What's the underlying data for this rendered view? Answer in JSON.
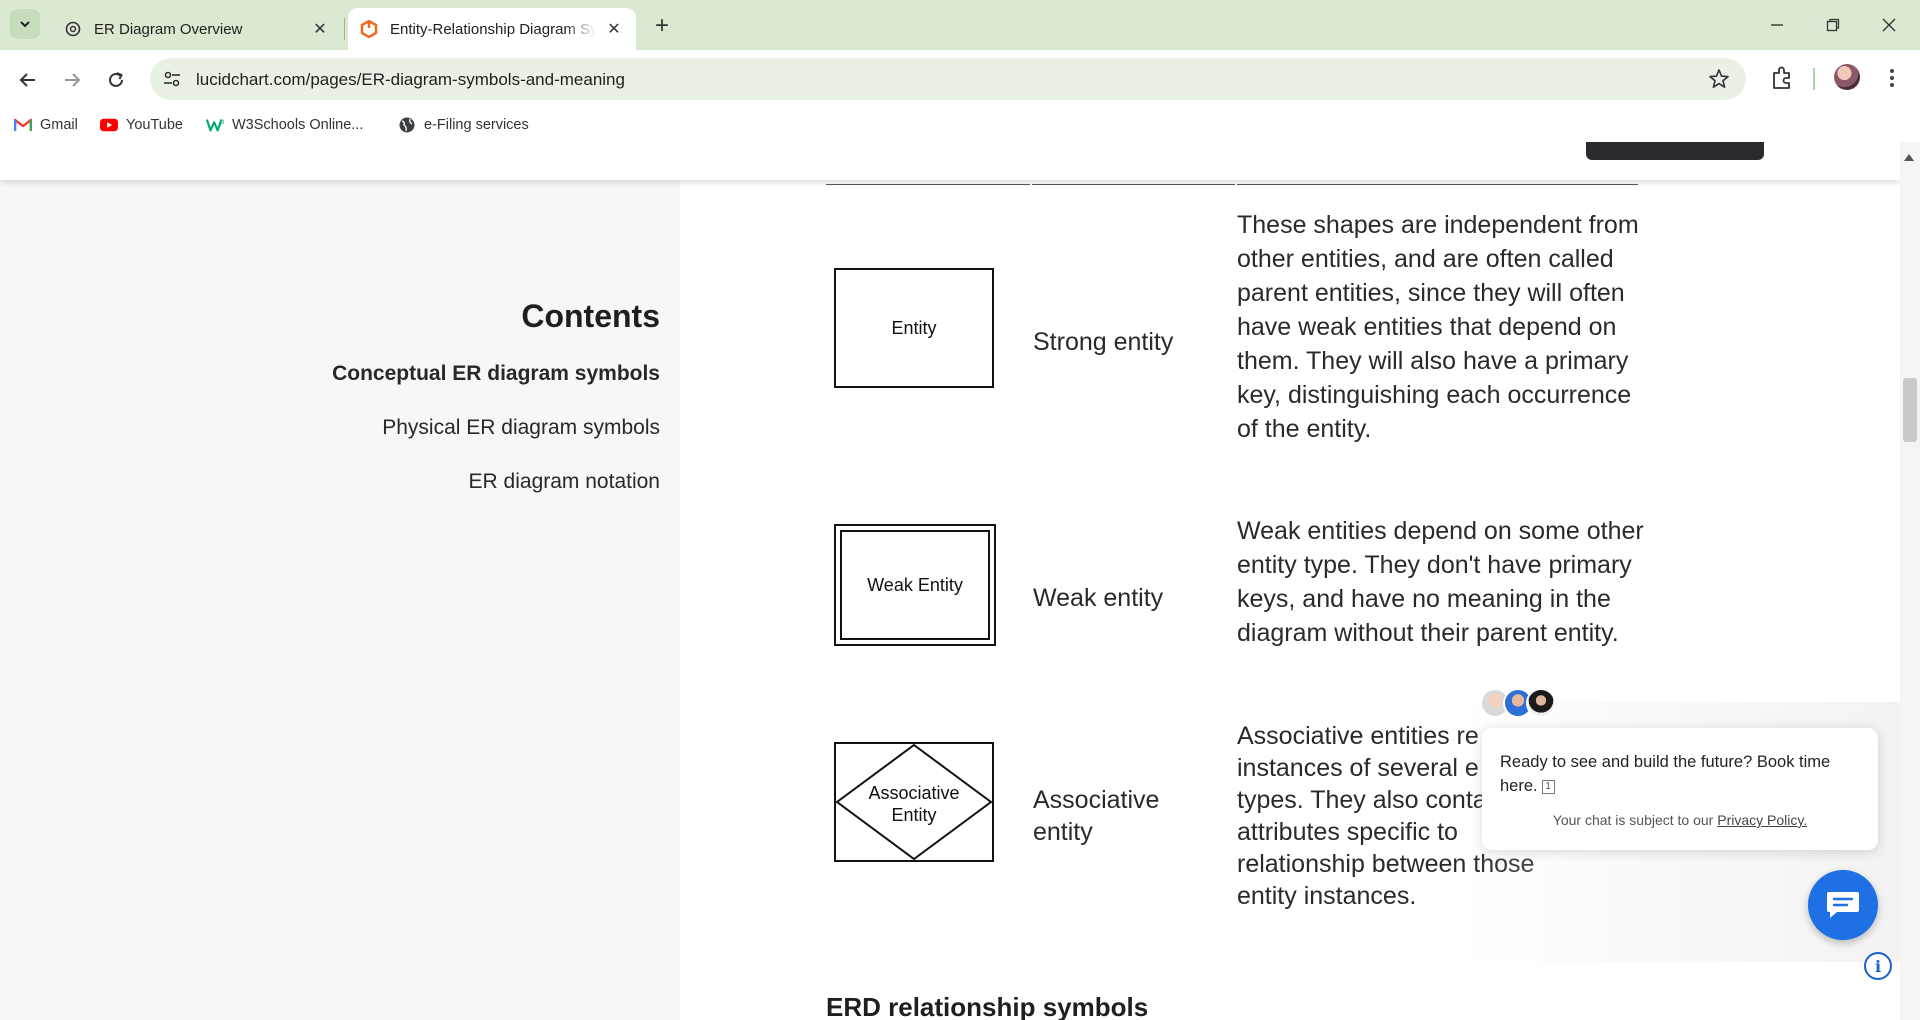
{
  "browser": {
    "tabs": [
      {
        "title": "ER Diagram Overview",
        "icon": "chatgpt-icon",
        "active": false
      },
      {
        "title": "Entity-Relationship Diagram Symbols and Meaning",
        "icon": "lucidchart-icon",
        "active": true
      }
    ],
    "url": "lucidchart.com/pages/ER-diagram-symbols-and-meaning",
    "bookmarks": [
      {
        "label": "Gmail",
        "icon": "gmail-icon"
      },
      {
        "label": "YouTube",
        "icon": "youtube-icon"
      },
      {
        "label": "W3Schools Online...",
        "icon": "w3schools-icon"
      },
      {
        "label": "e-Filing services",
        "icon": "globe-icon"
      }
    ]
  },
  "sidebar": {
    "title": "Contents",
    "items": [
      {
        "label": "Conceptual ER diagram symbols",
        "active": true
      },
      {
        "label": "Physical ER diagram symbols",
        "active": false
      },
      {
        "label": "ER diagram notation",
        "active": false
      }
    ]
  },
  "table": {
    "rows": [
      {
        "symbol_label": "Entity",
        "name": "Strong entity",
        "description": "These shapes are independent from other entities, and are often called parent entities, since they will often have weak entities that depend on them. They will also have a primary key, distinguishing each occurrence of the entity."
      },
      {
        "symbol_label": "Weak Entity",
        "name": "Weak entity",
        "description": "Weak entities depend on some other entity type. They don't have primary keys, and have no meaning in the diagram without their parent entity."
      },
      {
        "symbol_label": "Associative Entity",
        "symbol_label_lines": [
          "Associative",
          "Entity"
        ],
        "name": "Associative entity",
        "name_lines": [
          "Associative",
          "entity"
        ],
        "description": "Associative entities re… instances of several e… types. They also conta… attributes specific to … relationship between those entity instances.",
        "description_lines": [
          "Associative entities re",
          "instances of several e",
          "types. They also conta",
          "attributes specific to",
          "relationship between those",
          "entity instances."
        ]
      }
    ]
  },
  "next_section": "ERD relationship symbols",
  "chat": {
    "message": "Ready to see and build the future? Book time here.",
    "ref": "1",
    "privacy_prefix": "Your chat is subject to our",
    "privacy_link": "Privacy Policy.",
    "accent": "#1f6fe5"
  }
}
